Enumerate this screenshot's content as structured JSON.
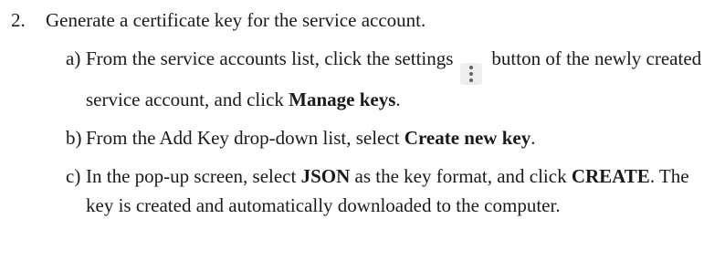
{
  "step": {
    "number": "2.",
    "text": "Generate a certificate key for the service account."
  },
  "substeps": [
    {
      "letter": "a)",
      "before_icon": "From the service accounts list, click the settings",
      "icon": "kebab-menu-icon",
      "after_icon": "button of the newly created service account, and click",
      "bold": "Manage keys",
      "tail": "."
    },
    {
      "letter": "b)",
      "before": "From the Add Key drop-down list, select",
      "bold": "Create new key",
      "tail": "."
    },
    {
      "letter": "c)",
      "before": "In the pop-up screen, select",
      "bold1": "JSON",
      "middle": "as the key format, and click",
      "bold2": "CREATE",
      "tail": ". The key is created and automatically downloaded to the computer."
    }
  ]
}
